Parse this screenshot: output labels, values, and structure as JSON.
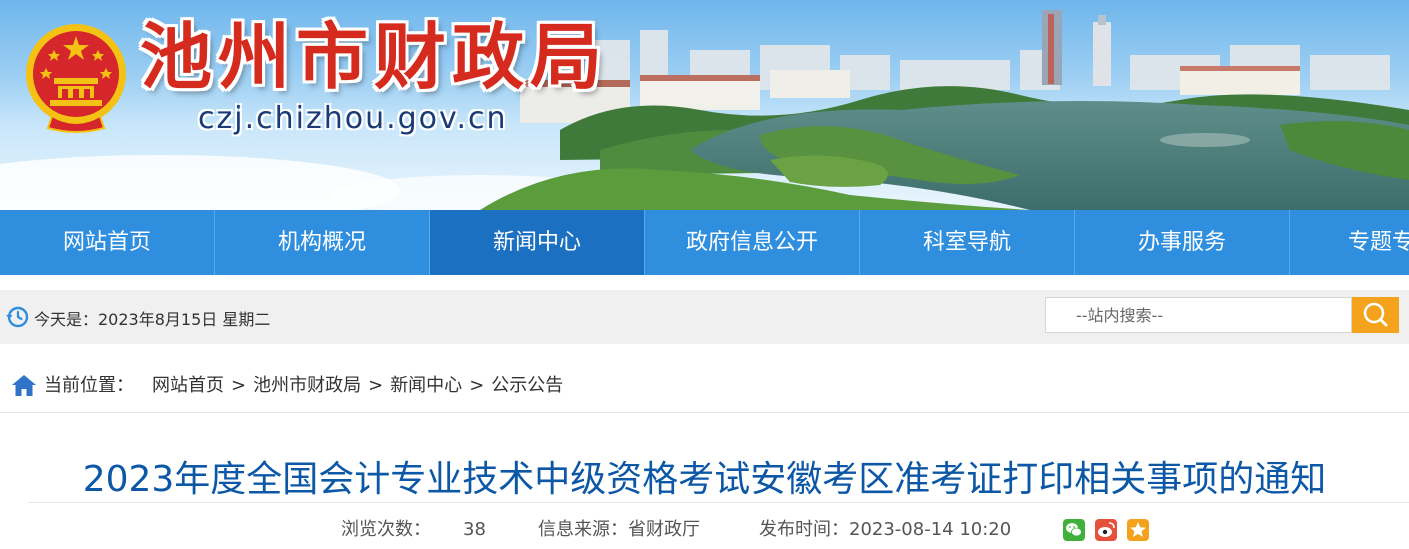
{
  "header": {
    "site_name": "池州市财政局",
    "domain": "czj.chizhou.gov.cn"
  },
  "nav": {
    "items": [
      {
        "label": "网站首页"
      },
      {
        "label": "机构概况"
      },
      {
        "label": "新闻中心",
        "active": true
      },
      {
        "label": "政府信息公开"
      },
      {
        "label": "科室导航"
      },
      {
        "label": "办事服务"
      },
      {
        "label": "专题专"
      }
    ]
  },
  "info_bar": {
    "date_text": "今天是：2023年8月15日 星期二",
    "search_placeholder": "--站内搜索--"
  },
  "breadcrumb": {
    "prefix": "当前位置：",
    "items": [
      "网站首页",
      "池州市财政局",
      "新闻中心",
      "公示公告"
    ],
    "separator": ">"
  },
  "article": {
    "title": "2023年度全国会计专业技术中级资格考试安徽考区准考证打印相关事项的通知",
    "views_label": "浏览次数：",
    "views": "38",
    "source_label": "信息来源：省财政厅",
    "publish_label": "发布时间：2023-08-14 10:20",
    "share_icons": [
      "wechat-icon",
      "weibo-icon",
      "favorite-icon"
    ]
  },
  "colors": {
    "site_red": "#d52b1e",
    "nav_blue": "#2f8fde",
    "nav_active": "#1c70c1",
    "title_blue": "#0c57a6",
    "search_orange": "#f5a31c"
  }
}
